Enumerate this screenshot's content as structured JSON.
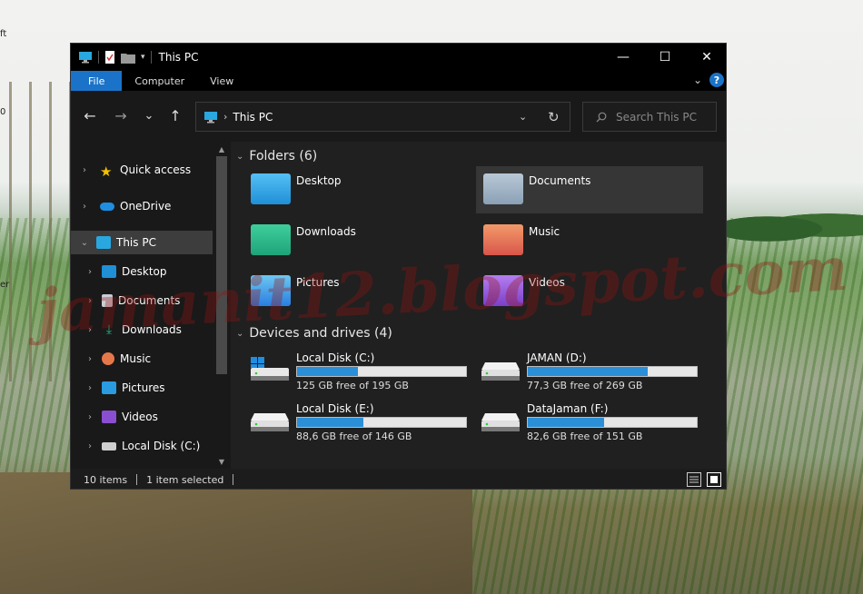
{
  "desktop": {
    "labels": [
      "ft",
      "0",
      "er"
    ],
    "watermark": "jamanit12.blogspot.com"
  },
  "window": {
    "title": "This PC",
    "controls": {
      "minimize": "—",
      "maximize": "☐",
      "close": "✕"
    }
  },
  "ribbon": {
    "tabs": [
      "File",
      "Computer",
      "View"
    ],
    "help": "?"
  },
  "navigation": {
    "back": "←",
    "forward": "→",
    "recent": "⌄",
    "up": "↑",
    "address": "This PC",
    "refresh": "↻",
    "search_placeholder": "Search This PC"
  },
  "sidebar": {
    "items": [
      {
        "label": "Quick access",
        "icon": "star-icon"
      },
      {
        "label": "OneDrive",
        "icon": "cloud-icon"
      },
      {
        "label": "This PC",
        "icon": "computer-icon",
        "selected": true
      },
      {
        "label": "Desktop",
        "icon": "desktop-folder-icon"
      },
      {
        "label": "Documents",
        "icon": "documents-folder-icon"
      },
      {
        "label": "Downloads",
        "icon": "downloads-folder-icon"
      },
      {
        "label": "Music",
        "icon": "music-folder-icon"
      },
      {
        "label": "Pictures",
        "icon": "pictures-folder-icon"
      },
      {
        "label": "Videos",
        "icon": "videos-folder-icon"
      },
      {
        "label": "Local Disk (C:)",
        "icon": "drive-icon"
      }
    ]
  },
  "folders": {
    "header": "Folders (6)",
    "items": [
      {
        "name": "Desktop",
        "icon": "desktop-folder-icon",
        "color": "#1f8fd6"
      },
      {
        "name": "Documents",
        "icon": "documents-folder-icon",
        "color": "#8aa0b5",
        "selected": true
      },
      {
        "name": "Downloads",
        "icon": "downloads-folder-icon",
        "color": "#1fa37a"
      },
      {
        "name": "Music",
        "icon": "music-folder-icon",
        "color": "#e5784b"
      },
      {
        "name": "Pictures",
        "icon": "pictures-folder-icon",
        "color": "#2a9be0"
      },
      {
        "name": "Videos",
        "icon": "videos-folder-icon",
        "color": "#8a4fd0"
      }
    ]
  },
  "drives": {
    "header": "Devices and drives (4)",
    "items": [
      {
        "name": "Local Disk (C:)",
        "free": "125 GB free of 195 GB",
        "used_fraction": 0.36,
        "icon": "windows-drive-icon"
      },
      {
        "name": "JAMAN (D:)",
        "free": "77,3 GB free of 269 GB",
        "used_fraction": 0.71,
        "icon": "drive-icon"
      },
      {
        "name": "Local Disk (E:)",
        "free": "88,6 GB free of 146 GB",
        "used_fraction": 0.39,
        "icon": "drive-icon"
      },
      {
        "name": "DataJaman (F:)",
        "free": "82,6 GB free of 151 GB",
        "used_fraction": 0.45,
        "icon": "drive-icon"
      }
    ]
  },
  "status": {
    "items_count": "10 items",
    "selection": "1 item selected"
  },
  "colors": {
    "accent": "#1a73c8",
    "progress": "#2b8fd8",
    "window_bg": "#191919"
  }
}
